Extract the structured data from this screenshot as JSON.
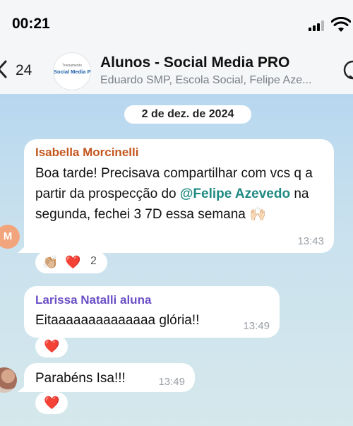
{
  "status_bar": {
    "time": "00:21"
  },
  "header": {
    "back_count": "24",
    "avatar_small": "Treinamento",
    "avatar_brand": "Social Media PRO",
    "title": "Alunos - Social Media PRO",
    "members": "Eduardo SMP, Escola Social, Felipe Aze..."
  },
  "date_separator": "2 de dez. de 2024",
  "messages": [
    {
      "sender": "Isabella Morcinelli",
      "text_before": "Boa tarde! Precisava compartilhar com vcs q a partir da prospecção do ",
      "mention": "@Felipe Azevedo",
      "text_after": " na segunda, fechei 3 7D essa semana 🙌🏻",
      "time": "13:43",
      "avatar_initial": "M",
      "reactions": {
        "emojis": [
          "👏🏼",
          "❤️"
        ],
        "count": "2"
      }
    },
    {
      "sender": "Larissa Natalli aluna",
      "text": "Eitaaaaaaaaaaaaaa glória!!",
      "time": "13:49",
      "reactions": {
        "emojis": [
          "❤️"
        ]
      }
    },
    {
      "text": "Parabéns Isa!!!",
      "time": "13:49",
      "reactions": {
        "emojis": [
          "❤️"
        ]
      }
    }
  ],
  "colors": {
    "sender1": "#c4561e",
    "sender2": "#6a4fc6",
    "mention": "#1f8a82",
    "chat_bg": "#b7d7ef"
  }
}
